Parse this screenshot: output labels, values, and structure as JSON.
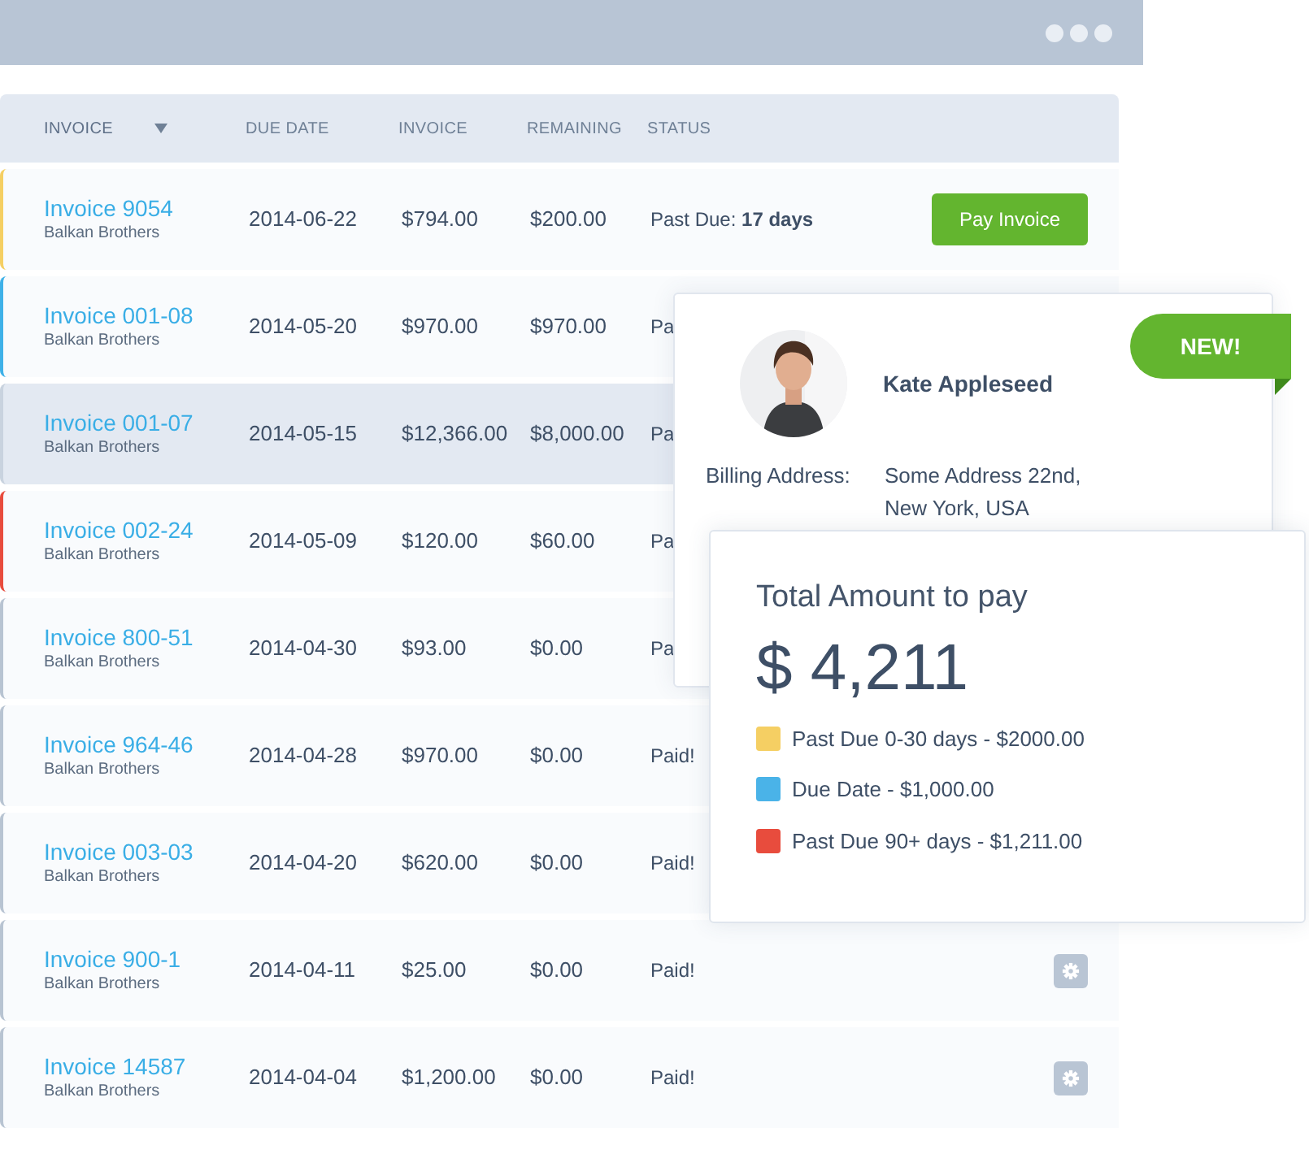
{
  "table": {
    "columns": [
      {
        "label": "INVOICE",
        "sortable": true
      },
      {
        "label": "DUE DATE",
        "sortable": false
      },
      {
        "label": "INVOICE",
        "sortable": false
      },
      {
        "label": "REMAINING",
        "sortable": false
      },
      {
        "label": "STATUS",
        "sortable": false
      }
    ],
    "rows": [
      {
        "invoice": "Invoice 9054",
        "client": "Balkan Brothers",
        "due_date": "2014-06-22",
        "amount": "$794.00",
        "remaining": "$200.00",
        "status": "Past Due: **17 days**",
        "action": {
          "kind": "pay",
          "label": "Pay Invoice"
        },
        "color": "#f5cf63",
        "selected": false
      },
      {
        "invoice": "Invoice 001-08",
        "client": "Balkan Brothers",
        "due_date": "2014-05-20",
        "amount": "$970.00",
        "remaining": "$970.00",
        "status": "Pa",
        "color": "#3fb1e8",
        "selected": false
      },
      {
        "invoice": "Invoice 001-07",
        "client": "Balkan Brothers",
        "due_date": "2014-05-15",
        "amount": "$12,366.00",
        "remaining": "$8,000.00",
        "status": "Pa",
        "color": "#c9d3df",
        "selected": true
      },
      {
        "invoice": "Invoice 002-24",
        "client": "Balkan Brothers",
        "due_date": "2014-05-09",
        "amount": "$120.00",
        "remaining": "$60.00",
        "status": "Pa",
        "color": "#e84c3d",
        "selected": false
      },
      {
        "invoice": "Invoice 800-51",
        "client": "Balkan Brothers",
        "due_date": "2014-04-30",
        "amount": "$93.00",
        "remaining": "$0.00",
        "status": "Pa",
        "color": "#b8c4d2",
        "selected": false
      },
      {
        "invoice": "Invoice 964-46",
        "client": "Balkan Brothers",
        "due_date": "2014-04-28",
        "amount": "$970.00",
        "remaining": "$0.00",
        "status": "Paid!",
        "color": "#b8c4d2",
        "selected": false
      },
      {
        "invoice": "Invoice 003-03",
        "client": "Balkan Brothers",
        "due_date": "2014-04-20",
        "amount": "$620.00",
        "remaining": "$0.00",
        "status": "Paid!",
        "color": "#b8c4d2",
        "selected": false
      },
      {
        "invoice": "Invoice 900-1",
        "client": "Balkan Brothers",
        "due_date": "2014-04-11",
        "amount": "$25.00",
        "remaining": "$0.00",
        "status": "Paid!",
        "action": {
          "kind": "settings"
        },
        "color": "#b8c4d2",
        "selected": false
      },
      {
        "invoice": "Invoice 14587",
        "client": "Balkan Brothers",
        "due_date": "2014-04-04",
        "amount": "$1,200.00",
        "remaining": "$0.00",
        "status": "Paid!",
        "action": {
          "kind": "settings"
        },
        "color": "#b8c4d2",
        "selected": false
      }
    ]
  },
  "profile_card": {
    "badge": "NEW!",
    "photo": {
      "kind": "picture"
    },
    "name": "Kate Appleseed",
    "billing_label": "Billing Address:",
    "billing_lines": [
      "Some Address 22nd,",
      "New York, USA"
    ]
  },
  "total_card": {
    "title": "Total Amount to pay",
    "amount": "$ 4,211",
    "legend": [
      {
        "label": "Past Due 0-30 days - $2000.00",
        "color": "#f5cf63"
      },
      {
        "label": "Due Date - $1,000.00",
        "color": "#4ab3e8"
      },
      {
        "label": "Past Due 90+ days - $1,211.00",
        "color": "#e84c3d"
      }
    ]
  }
}
